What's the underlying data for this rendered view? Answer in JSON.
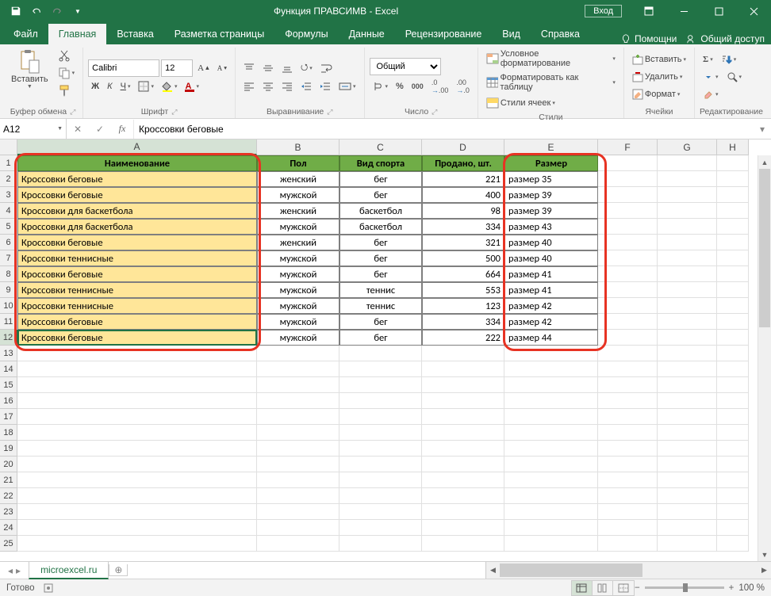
{
  "app": {
    "title": "Функция ПРАВСИМВ  -  Excel",
    "signin": "Вход"
  },
  "tabs": [
    "Файл",
    "Главная",
    "Вставка",
    "Разметка страницы",
    "Формулы",
    "Данные",
    "Рецензирование",
    "Вид",
    "Справка"
  ],
  "tabs_right": {
    "help_hint": "Помощни",
    "share": "Общий доступ"
  },
  "ribbon": {
    "clipboard": {
      "paste": "Вставить",
      "group": "Буфер обмена"
    },
    "font": {
      "name": "Calibri",
      "size": "12",
      "bold": "Ж",
      "italic": "К",
      "underline": "Ч",
      "group": "Шрифт"
    },
    "alignment": {
      "group": "Выравнивание"
    },
    "number": {
      "category": "Общий",
      "group": "Число"
    },
    "styles": {
      "cond": "Условное форматирование",
      "table": "Форматировать как таблицу",
      "cell": "Стили ячеек",
      "group": "Стили"
    },
    "cells": {
      "insert": "Вставить",
      "delete": "Удалить",
      "format": "Формат",
      "group": "Ячейки"
    },
    "editing": {
      "group": "Редактирование"
    }
  },
  "namebox": "A12",
  "formula": "Кроссовки беговые",
  "columns": {
    "A": 302,
    "B": 104,
    "C": 104,
    "D": 104,
    "E": 118,
    "F": 75,
    "G": 75,
    "H": 40
  },
  "headers": [
    "Наименование",
    "Пол",
    "Вид спорта",
    "Продано, шт.",
    "Размер"
  ],
  "rows": [
    [
      "Кроссовки беговые",
      "женский",
      "бег",
      "221",
      "размер 35"
    ],
    [
      "Кроссовки беговые",
      "мужской",
      "бег",
      "400",
      "размер 39"
    ],
    [
      "Кроссовки для баскетбола",
      "женский",
      "баскетбол",
      "98",
      "размер 39"
    ],
    [
      "Кроссовки для баскетбола",
      "мужской",
      "баскетбол",
      "334",
      "размер 43"
    ],
    [
      "Кроссовки беговые",
      "женский",
      "бег",
      "321",
      "размер 40"
    ],
    [
      "Кроссовки теннисные",
      "мужской",
      "бег",
      "500",
      "размер 40"
    ],
    [
      "Кроссовки беговые",
      "мужской",
      "бег",
      "664",
      "размер 41"
    ],
    [
      "Кроссовки теннисные",
      "мужской",
      "теннис",
      "553",
      "размер 41"
    ],
    [
      "Кроссовки теннисные",
      "мужской",
      "теннис",
      "123",
      "размер 42"
    ],
    [
      "Кроссовки беговые",
      "мужской",
      "бег",
      "334",
      "размер 42"
    ],
    [
      "Кроссовки беговые",
      "мужской",
      "бег",
      "222",
      "размер 44"
    ]
  ],
  "sheet": {
    "name": "microexcel.ru"
  },
  "status": {
    "ready": "Готово",
    "zoom": "100 %"
  }
}
